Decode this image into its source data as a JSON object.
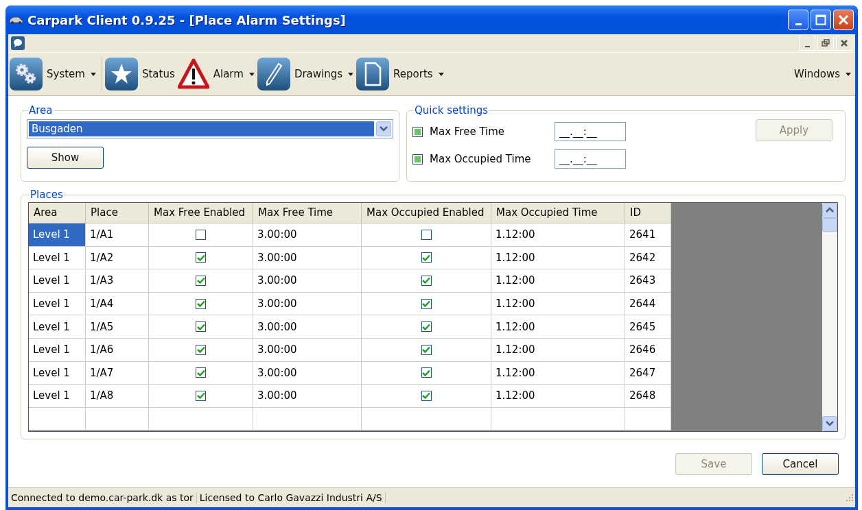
{
  "window": {
    "title": "Carpark Client 0.9.25 - [Place Alarm Settings]"
  },
  "toolbar": [
    {
      "label": "System",
      "dropdown": true
    },
    {
      "label": "Status",
      "dropdown": false
    },
    {
      "label": "Alarm",
      "dropdown": true
    },
    {
      "label": "Drawings",
      "dropdown": true
    },
    {
      "label": "Reports",
      "dropdown": true
    }
  ],
  "windows_menu": {
    "label": "Windows"
  },
  "area": {
    "title": "Area",
    "value": "Busgaden",
    "show_button": "Show"
  },
  "quick_settings": {
    "title": "Quick settings",
    "items": [
      {
        "label": "Max Free Time",
        "indeterminate": true,
        "value": "__.__:__"
      },
      {
        "label": "Max Occupied Time",
        "indeterminate": true,
        "value": "__.__:__"
      }
    ],
    "apply": {
      "label": "Apply",
      "disabled": true
    }
  },
  "places": {
    "title": "Places",
    "columns": [
      "Area",
      "Place",
      "Max Free Enabled",
      "Max Free Time",
      "Max Occupied Enabled",
      "Max Occupied Time",
      "ID"
    ],
    "rows": [
      {
        "area": "Level 1",
        "place": "1/A1",
        "free_enabled": false,
        "free_time": "3.00:00",
        "occ_enabled": false,
        "occ_time": "1.12:00",
        "id": "2641",
        "selected": true
      },
      {
        "area": "Level 1",
        "place": "1/A2",
        "free_enabled": true,
        "free_time": "3.00:00",
        "occ_enabled": true,
        "occ_time": "1.12:00",
        "id": "2642",
        "selected": false
      },
      {
        "area": "Level 1",
        "place": "1/A3",
        "free_enabled": true,
        "free_time": "3.00:00",
        "occ_enabled": true,
        "occ_time": "1.12:00",
        "id": "2643",
        "selected": false
      },
      {
        "area": "Level 1",
        "place": "1/A4",
        "free_enabled": true,
        "free_time": "3.00:00",
        "occ_enabled": true,
        "occ_time": "1.12:00",
        "id": "2644",
        "selected": false
      },
      {
        "area": "Level 1",
        "place": "1/A5",
        "free_enabled": true,
        "free_time": "3.00:00",
        "occ_enabled": true,
        "occ_time": "1.12:00",
        "id": "2645",
        "selected": false
      },
      {
        "area": "Level 1",
        "place": "1/A6",
        "free_enabled": true,
        "free_time": "3.00:00",
        "occ_enabled": true,
        "occ_time": "1.12:00",
        "id": "2646",
        "selected": false
      },
      {
        "area": "Level 1",
        "place": "1/A7",
        "free_enabled": true,
        "free_time": "3.00:00",
        "occ_enabled": true,
        "occ_time": "1.12:00",
        "id": "2647",
        "selected": false
      },
      {
        "area": "Level 1",
        "place": "1/A8",
        "free_enabled": true,
        "free_time": "3.00:00",
        "occ_enabled": true,
        "occ_time": "1.12:00",
        "id": "2648",
        "selected": false
      }
    ]
  },
  "buttons": [
    {
      "label": "Save",
      "disabled": true
    },
    {
      "label": "Cancel",
      "disabled": false
    }
  ],
  "status_bar": [
    "Connected to demo.car-park.dk as tor",
    "Licensed to Carlo Gavazzi Industri A/S"
  ]
}
